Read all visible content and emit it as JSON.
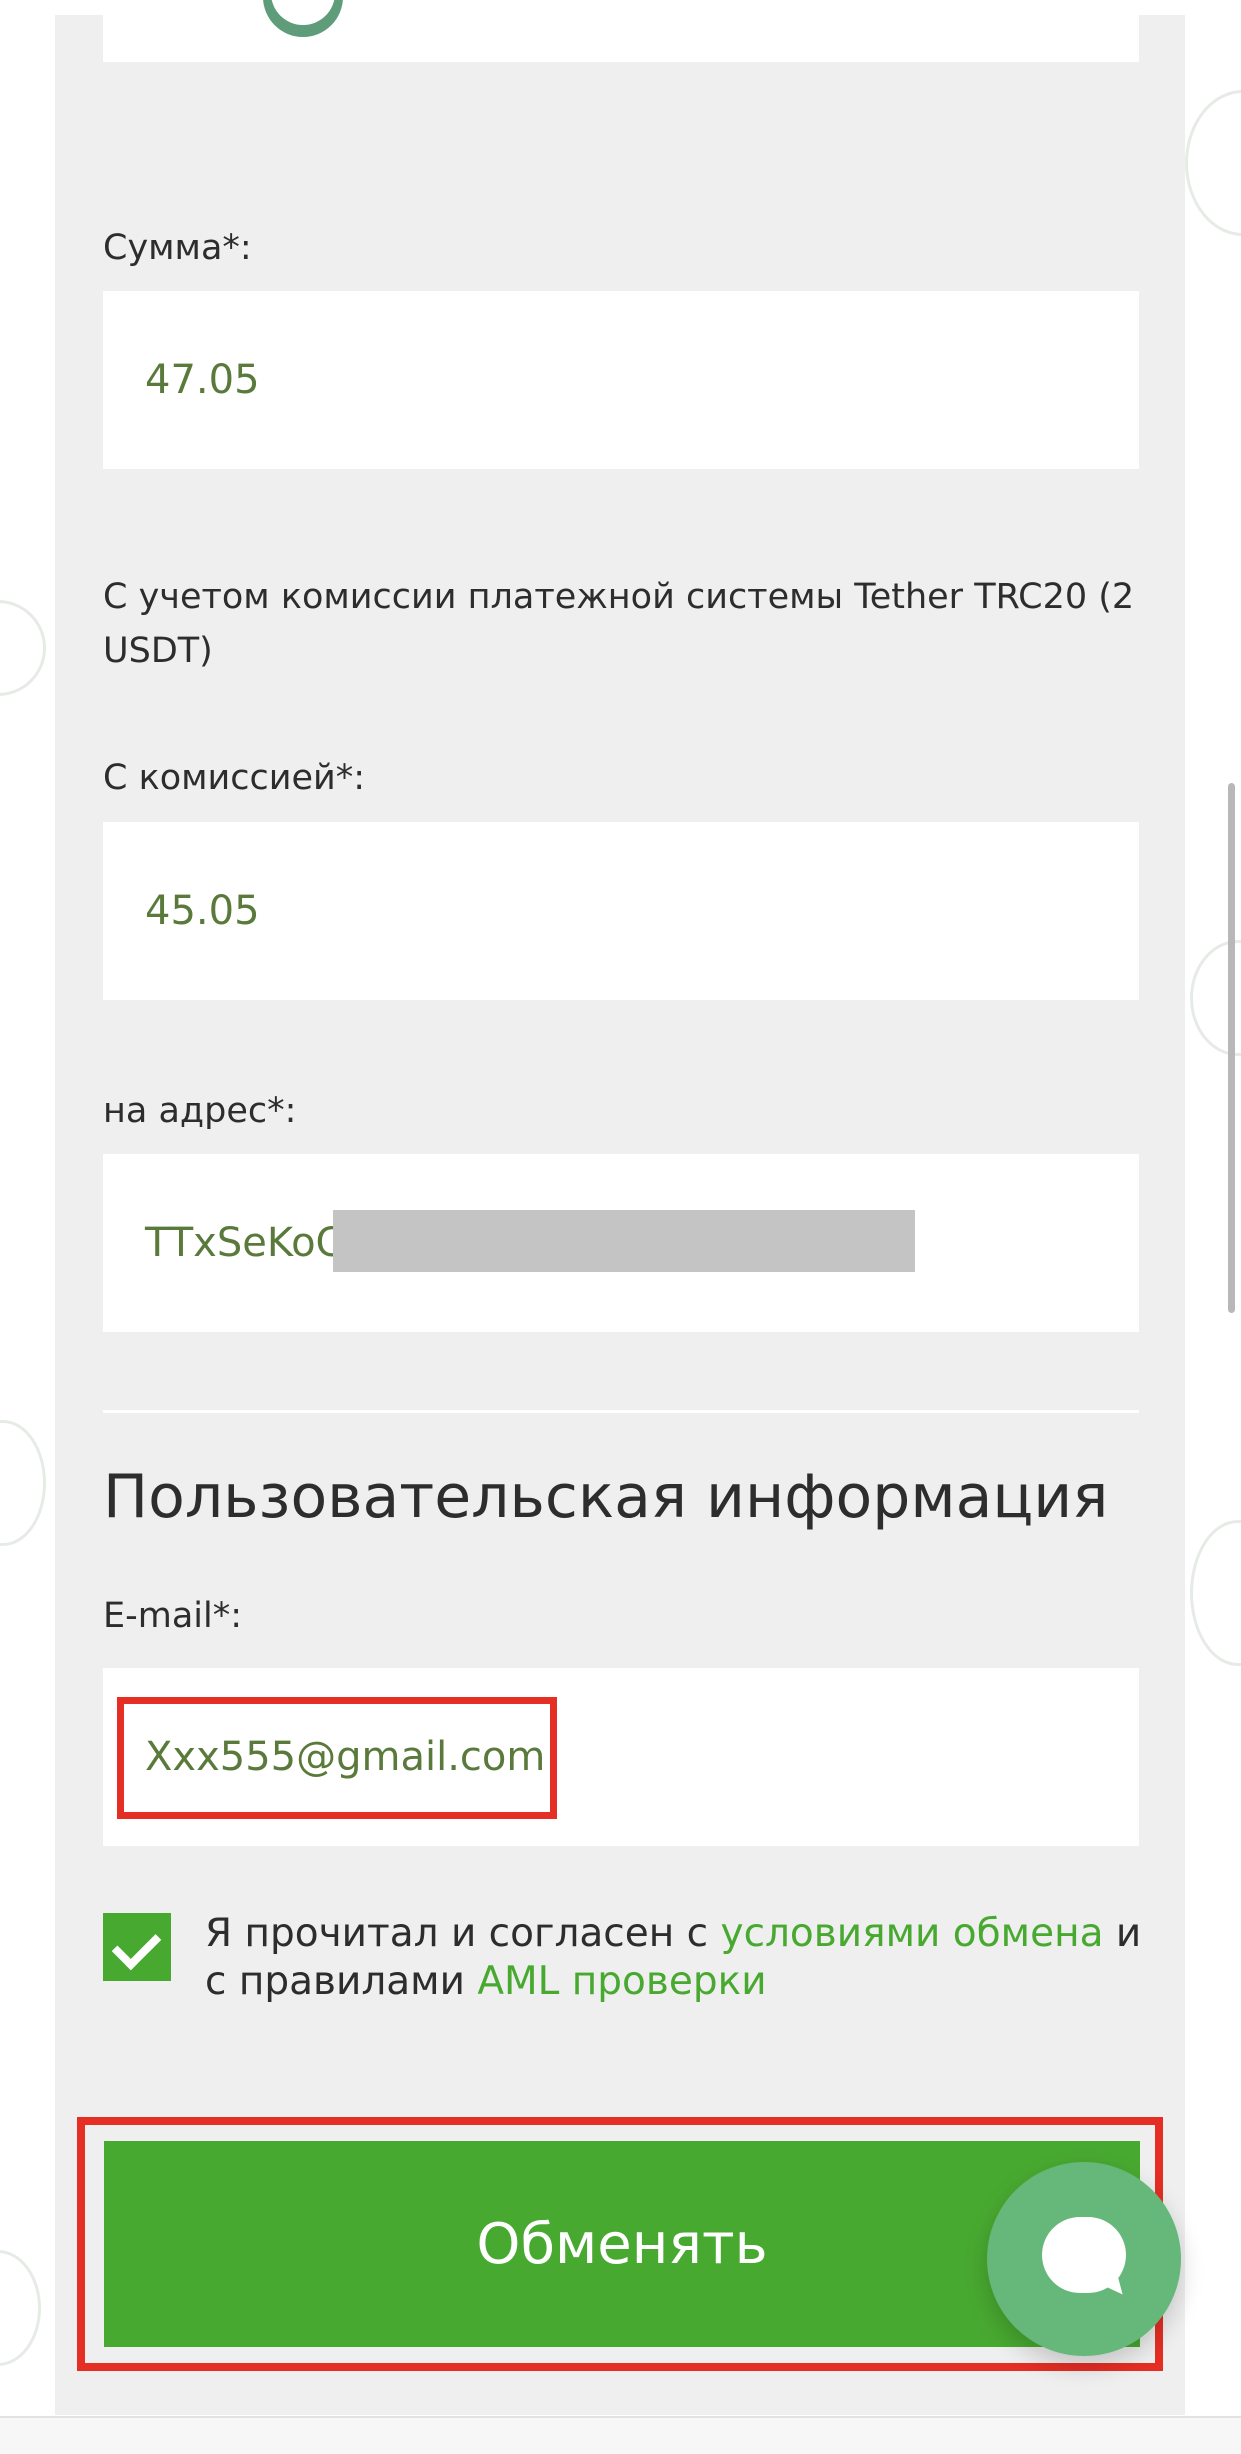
{
  "form": {
    "amount": {
      "label": "Сумма*:",
      "value": "47.05"
    },
    "fee_note": "С учетом комиссии платежной системы Tether TRC20 (2 USDT)",
    "with_fee": {
      "label": "С комиссией*:",
      "value": "45.05"
    },
    "address": {
      "label": "на адрес*:",
      "value": "TTxSeKoC"
    },
    "user_info": {
      "title": "Пользовательская информация",
      "email_label": "E-mail*:",
      "email_value": "Xxx555@gmail.com"
    },
    "consent": {
      "checked": true,
      "text_1": "Я прочитал и согласен с",
      "link_terms": "условиями обмена",
      "text_2": "и",
      "text_3": "с правилами",
      "link_aml": "AML проверки"
    },
    "submit_label": "Обменять"
  },
  "colors": {
    "accent_green": "#48a930",
    "value_text": "#5a7a3c",
    "highlight_red": "#e52e24",
    "chat_green": "#66b77a"
  },
  "icons": {
    "chat": "chat-bubble-icon",
    "checkbox": "checkmark-icon"
  }
}
